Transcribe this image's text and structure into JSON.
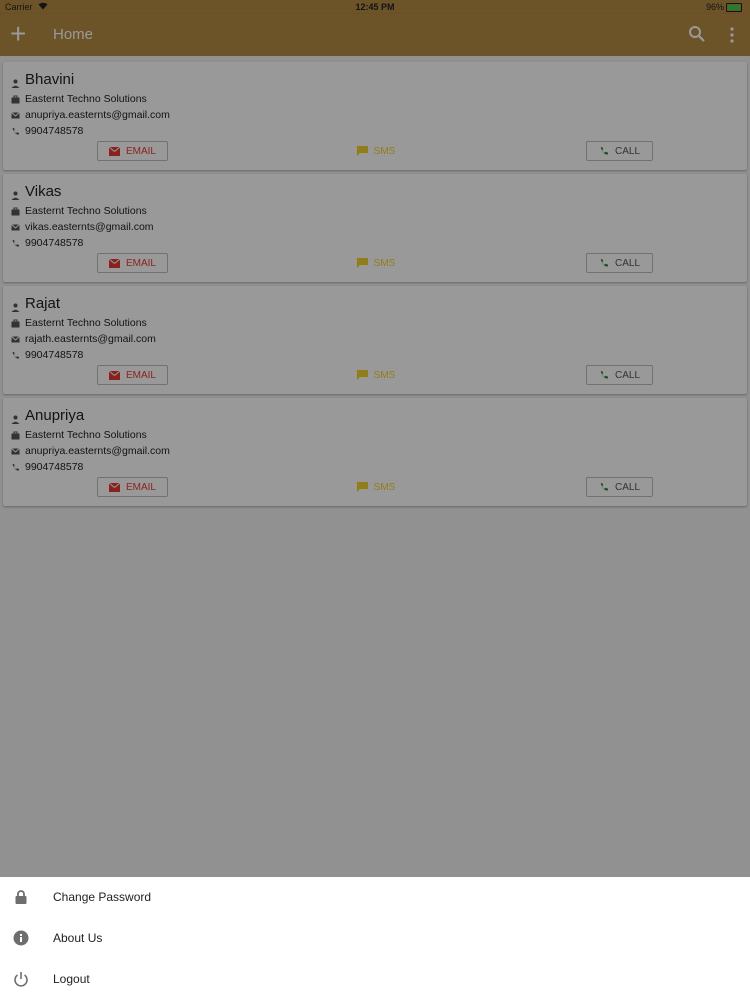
{
  "status_bar": {
    "carrier": "Carrier",
    "time": "12:45 PM",
    "battery": "96%"
  },
  "app_bar": {
    "title": "Home",
    "add_icon": "plus-icon",
    "search_icon": "search-icon",
    "menu_icon": "more-vert-icon"
  },
  "contacts": [
    {
      "name": "Bhavini",
      "company": "Easternt Techno Solutions",
      "email": "anupriya.easternts@gmail.com",
      "phone": "9904748578"
    },
    {
      "name": "Vikas",
      "company": "Easternt Techno Solutions",
      "email": "vikas.easternts@gmail.com",
      "phone": "9904748578"
    },
    {
      "name": "Rajat",
      "company": "Easternt Techno Solutions",
      "email": "rajath.easternts@gmail.com",
      "phone": "9904748578"
    },
    {
      "name": "Anupriya",
      "company": "Easternt Techno Solutions",
      "email": "anupriya.easternts@gmail.com",
      "phone": "9904748578"
    }
  ],
  "actions": {
    "email_label": "EMAIL",
    "sms_label": "SMS",
    "call_label": "CALL"
  },
  "bottom_sheet": {
    "items": [
      {
        "label": "Change Password",
        "icon": "lock-icon"
      },
      {
        "label": "About Us",
        "icon": "info-icon"
      },
      {
        "label": "Logout",
        "icon": "power-icon"
      }
    ]
  },
  "colors": {
    "app_bar": "#b58a44",
    "email": "#e53935",
    "sms": "#f2d22a",
    "overlay": "rgba(0,0,0,0.4)"
  }
}
